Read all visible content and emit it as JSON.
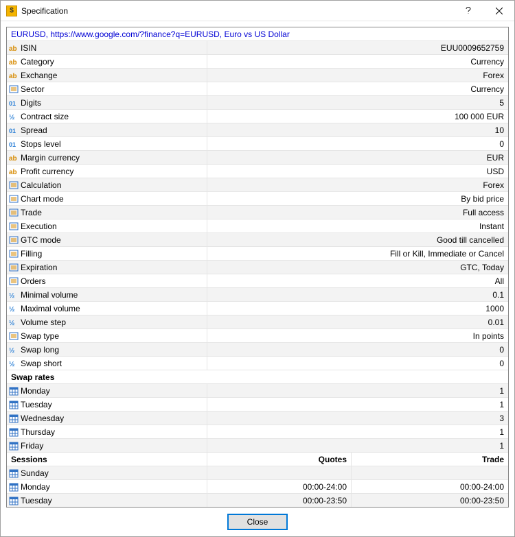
{
  "window": {
    "title": "Specification"
  },
  "header": "EURUSD, https://www.google.com/?finance?q=EURUSD, Euro vs US Dollar",
  "rows": [
    {
      "icon": "ab",
      "label": "ISIN",
      "value": "EUU0009652759"
    },
    {
      "icon": "ab",
      "label": "Category",
      "value": "Currency"
    },
    {
      "icon": "ab",
      "label": "Exchange",
      "value": "Forex"
    },
    {
      "icon": "list",
      "label": "Sector",
      "value": "Currency"
    },
    {
      "icon": "01",
      "label": "Digits",
      "value": "5"
    },
    {
      "icon": "half",
      "label": "Contract size",
      "value": "100 000 EUR"
    },
    {
      "icon": "01",
      "label": "Spread",
      "value": "10"
    },
    {
      "icon": "01",
      "label": "Stops level",
      "value": "0"
    },
    {
      "icon": "ab",
      "label": "Margin currency",
      "value": "EUR"
    },
    {
      "icon": "ab",
      "label": "Profit currency",
      "value": "USD"
    },
    {
      "icon": "list",
      "label": "Calculation",
      "value": "Forex"
    },
    {
      "icon": "list",
      "label": "Chart mode",
      "value": "By bid price"
    },
    {
      "icon": "list",
      "label": "Trade",
      "value": "Full access"
    },
    {
      "icon": "list",
      "label": "Execution",
      "value": "Instant"
    },
    {
      "icon": "list",
      "label": "GTC mode",
      "value": "Good till cancelled"
    },
    {
      "icon": "list",
      "label": "Filling",
      "value": "Fill or Kill, Immediate or Cancel"
    },
    {
      "icon": "list",
      "label": "Expiration",
      "value": "GTC, Today"
    },
    {
      "icon": "list",
      "label": "Orders",
      "value": "All"
    },
    {
      "icon": "half",
      "label": "Minimal volume",
      "value": "0.1"
    },
    {
      "icon": "half",
      "label": "Maximal volume",
      "value": "1000"
    },
    {
      "icon": "half",
      "label": "Volume step",
      "value": "0.01"
    },
    {
      "icon": "list",
      "label": "Swap type",
      "value": "In points"
    },
    {
      "icon": "half",
      "label": "Swap long",
      "value": "0"
    },
    {
      "icon": "half",
      "label": "Swap short",
      "value": "0"
    }
  ],
  "swap_rates": {
    "title": "Swap rates",
    "days": [
      {
        "icon": "cal",
        "label": "Monday",
        "value": "1"
      },
      {
        "icon": "cal",
        "label": "Tuesday",
        "value": "1"
      },
      {
        "icon": "cal",
        "label": "Wednesday",
        "value": "3"
      },
      {
        "icon": "cal",
        "label": "Thursday",
        "value": "1"
      },
      {
        "icon": "cal",
        "label": "Friday",
        "value": "1"
      }
    ]
  },
  "sessions": {
    "title": "Sessions",
    "quotes_col": "Quotes",
    "trade_col": "Trade",
    "rows": [
      {
        "icon": "cal",
        "label": "Sunday",
        "quotes": "",
        "trade": ""
      },
      {
        "icon": "cal",
        "label": "Monday",
        "quotes": "00:00-24:00",
        "trade": "00:00-24:00"
      },
      {
        "icon": "cal",
        "label": "Tuesday",
        "quotes": "00:00-23:50",
        "trade": "00:00-23:50"
      }
    ]
  },
  "buttons": {
    "close": "Close"
  }
}
